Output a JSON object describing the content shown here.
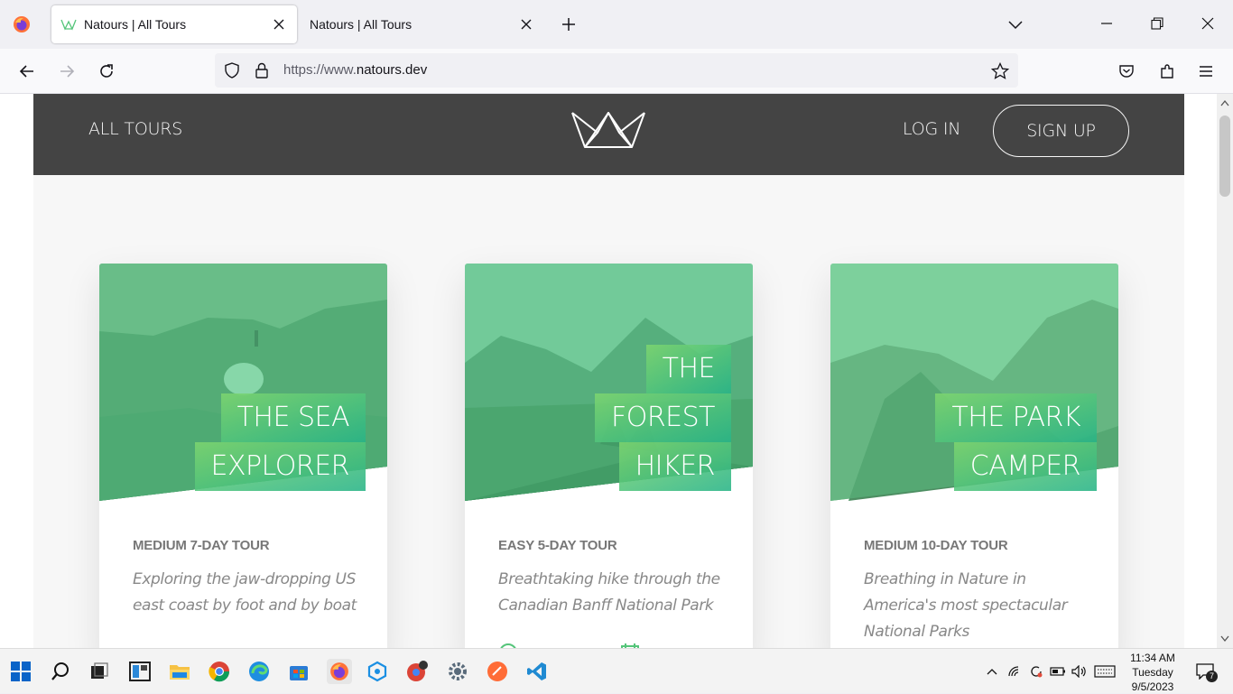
{
  "browser": {
    "tabs": [
      {
        "title": "Natours | All Tours",
        "active": true
      },
      {
        "title": "Natours | All Tours",
        "active": false
      }
    ],
    "url_prefix": "https://www.",
    "url_domain": "natours.dev"
  },
  "site": {
    "nav": {
      "all_tours": "ALL TOURS",
      "log_in": "LOG IN",
      "sign_up": "SIGN UP"
    },
    "tours": [
      {
        "title_lines": [
          "THE SEA",
          "EXPLORER"
        ],
        "subheading": "MEDIUM 7-DAY TOUR",
        "summary": "Exploring the jaw-dropping US east coast by foot and by boat"
      },
      {
        "title_lines": [
          "THE",
          "FOREST",
          "HIKER"
        ],
        "subheading": "EASY 5-DAY TOUR",
        "summary": "Breathtaking hike through the Canadian Banff National Park"
      },
      {
        "title_lines": [
          "THE PARK",
          "CAMPER"
        ],
        "subheading": "MEDIUM 10-DAY TOUR",
        "summary": "Breathing in Nature in America's most spectacular National Parks"
      }
    ]
  },
  "taskbar": {
    "time": "11:34 AM",
    "day": "Tuesday",
    "date": "9/5/2023",
    "notification_count": "7"
  },
  "colors": {
    "header_bg": "#444444",
    "page_bg": "#f7f7f7",
    "accent_green": "#55c57a"
  }
}
